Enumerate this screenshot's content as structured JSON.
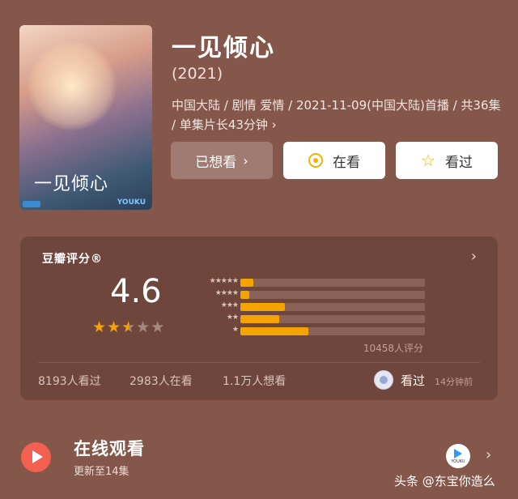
{
  "poster": {
    "title_text": "一见倾心",
    "logo_text": "YOUKU"
  },
  "title": "一见倾心",
  "year": "(2021)",
  "meta_line": "中国大陆 / 剧情 爱情 / 2021-11-09(中国大陆)首播 / 共36集 / 单集片长43分钟 ›",
  "buttons": {
    "want": "已想看",
    "watching": "在看",
    "seen": "看过"
  },
  "rating": {
    "title": "豆瓣评分®",
    "score": "4.6",
    "stars_filled": 2.5,
    "stars_total": 5,
    "distribution": [
      {
        "stars": "★★★★★",
        "percent": 7
      },
      {
        "stars": "★★★★",
        "percent": 5
      },
      {
        "stars": "★★★",
        "percent": 24
      },
      {
        "stars": "★★",
        "percent": 21
      },
      {
        "stars": "★",
        "percent": 37
      }
    ],
    "rating_count": "10458人评分",
    "stats": {
      "seen": "8193人看过",
      "watching": "2983人在看",
      "want": "1.1万人想看"
    },
    "my_status": "看过",
    "my_time": "14分钟前"
  },
  "online": {
    "title": "在线观看",
    "subtitle": "更新至14集",
    "platform": "YOUKU"
  },
  "watermark": "头条 @东宝你造么",
  "colors": {
    "accent": "#f5a300",
    "play": "#f3604f",
    "background": "#84574a"
  }
}
